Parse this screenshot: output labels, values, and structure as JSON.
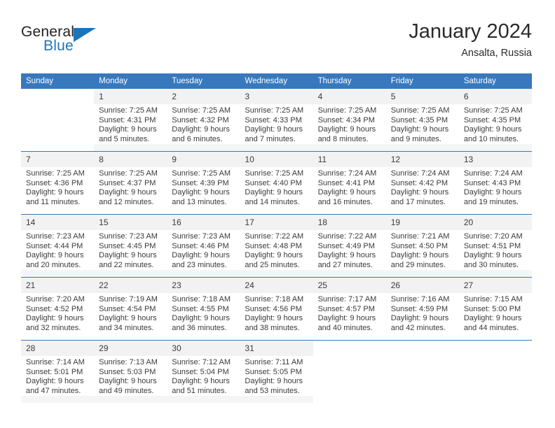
{
  "brand": {
    "name_part1": "General",
    "name_part2": "Blue",
    "logo_icon": "triangle-logo-icon",
    "accent_color": "#1b75bb"
  },
  "header": {
    "month_title": "January 2024",
    "location": "Ansalta, Russia"
  },
  "calendar": {
    "header_background": "#3878bd",
    "weekday_headers": [
      "Sunday",
      "Monday",
      "Tuesday",
      "Wednesday",
      "Thursday",
      "Friday",
      "Saturday"
    ],
    "weeks": [
      [
        {
          "day": "",
          "sunrise": "",
          "sunset": "",
          "daylight_line1": "",
          "daylight_line2": ""
        },
        {
          "day": "1",
          "sunrise": "Sunrise: 7:25 AM",
          "sunset": "Sunset: 4:31 PM",
          "daylight_line1": "Daylight: 9 hours",
          "daylight_line2": "and 5 minutes."
        },
        {
          "day": "2",
          "sunrise": "Sunrise: 7:25 AM",
          "sunset": "Sunset: 4:32 PM",
          "daylight_line1": "Daylight: 9 hours",
          "daylight_line2": "and 6 minutes."
        },
        {
          "day": "3",
          "sunrise": "Sunrise: 7:25 AM",
          "sunset": "Sunset: 4:33 PM",
          "daylight_line1": "Daylight: 9 hours",
          "daylight_line2": "and 7 minutes."
        },
        {
          "day": "4",
          "sunrise": "Sunrise: 7:25 AM",
          "sunset": "Sunset: 4:34 PM",
          "daylight_line1": "Daylight: 9 hours",
          "daylight_line2": "and 8 minutes."
        },
        {
          "day": "5",
          "sunrise": "Sunrise: 7:25 AM",
          "sunset": "Sunset: 4:35 PM",
          "daylight_line1": "Daylight: 9 hours",
          "daylight_line2": "and 9 minutes."
        },
        {
          "day": "6",
          "sunrise": "Sunrise: 7:25 AM",
          "sunset": "Sunset: 4:35 PM",
          "daylight_line1": "Daylight: 9 hours",
          "daylight_line2": "and 10 minutes."
        }
      ],
      [
        {
          "day": "7",
          "sunrise": "Sunrise: 7:25 AM",
          "sunset": "Sunset: 4:36 PM",
          "daylight_line1": "Daylight: 9 hours",
          "daylight_line2": "and 11 minutes."
        },
        {
          "day": "8",
          "sunrise": "Sunrise: 7:25 AM",
          "sunset": "Sunset: 4:37 PM",
          "daylight_line1": "Daylight: 9 hours",
          "daylight_line2": "and 12 minutes."
        },
        {
          "day": "9",
          "sunrise": "Sunrise: 7:25 AM",
          "sunset": "Sunset: 4:39 PM",
          "daylight_line1": "Daylight: 9 hours",
          "daylight_line2": "and 13 minutes."
        },
        {
          "day": "10",
          "sunrise": "Sunrise: 7:25 AM",
          "sunset": "Sunset: 4:40 PM",
          "daylight_line1": "Daylight: 9 hours",
          "daylight_line2": "and 14 minutes."
        },
        {
          "day": "11",
          "sunrise": "Sunrise: 7:24 AM",
          "sunset": "Sunset: 4:41 PM",
          "daylight_line1": "Daylight: 9 hours",
          "daylight_line2": "and 16 minutes."
        },
        {
          "day": "12",
          "sunrise": "Sunrise: 7:24 AM",
          "sunset": "Sunset: 4:42 PM",
          "daylight_line1": "Daylight: 9 hours",
          "daylight_line2": "and 17 minutes."
        },
        {
          "day": "13",
          "sunrise": "Sunrise: 7:24 AM",
          "sunset": "Sunset: 4:43 PM",
          "daylight_line1": "Daylight: 9 hours",
          "daylight_line2": "and 19 minutes."
        }
      ],
      [
        {
          "day": "14",
          "sunrise": "Sunrise: 7:23 AM",
          "sunset": "Sunset: 4:44 PM",
          "daylight_line1": "Daylight: 9 hours",
          "daylight_line2": "and 20 minutes."
        },
        {
          "day": "15",
          "sunrise": "Sunrise: 7:23 AM",
          "sunset": "Sunset: 4:45 PM",
          "daylight_line1": "Daylight: 9 hours",
          "daylight_line2": "and 22 minutes."
        },
        {
          "day": "16",
          "sunrise": "Sunrise: 7:23 AM",
          "sunset": "Sunset: 4:46 PM",
          "daylight_line1": "Daylight: 9 hours",
          "daylight_line2": "and 23 minutes."
        },
        {
          "day": "17",
          "sunrise": "Sunrise: 7:22 AM",
          "sunset": "Sunset: 4:48 PM",
          "daylight_line1": "Daylight: 9 hours",
          "daylight_line2": "and 25 minutes."
        },
        {
          "day": "18",
          "sunrise": "Sunrise: 7:22 AM",
          "sunset": "Sunset: 4:49 PM",
          "daylight_line1": "Daylight: 9 hours",
          "daylight_line2": "and 27 minutes."
        },
        {
          "day": "19",
          "sunrise": "Sunrise: 7:21 AM",
          "sunset": "Sunset: 4:50 PM",
          "daylight_line1": "Daylight: 9 hours",
          "daylight_line2": "and 29 minutes."
        },
        {
          "day": "20",
          "sunrise": "Sunrise: 7:20 AM",
          "sunset": "Sunset: 4:51 PM",
          "daylight_line1": "Daylight: 9 hours",
          "daylight_line2": "and 30 minutes."
        }
      ],
      [
        {
          "day": "21",
          "sunrise": "Sunrise: 7:20 AM",
          "sunset": "Sunset: 4:52 PM",
          "daylight_line1": "Daylight: 9 hours",
          "daylight_line2": "and 32 minutes."
        },
        {
          "day": "22",
          "sunrise": "Sunrise: 7:19 AM",
          "sunset": "Sunset: 4:54 PM",
          "daylight_line1": "Daylight: 9 hours",
          "daylight_line2": "and 34 minutes."
        },
        {
          "day": "23",
          "sunrise": "Sunrise: 7:18 AM",
          "sunset": "Sunset: 4:55 PM",
          "daylight_line1": "Daylight: 9 hours",
          "daylight_line2": "and 36 minutes."
        },
        {
          "day": "24",
          "sunrise": "Sunrise: 7:18 AM",
          "sunset": "Sunset: 4:56 PM",
          "daylight_line1": "Daylight: 9 hours",
          "daylight_line2": "and 38 minutes."
        },
        {
          "day": "25",
          "sunrise": "Sunrise: 7:17 AM",
          "sunset": "Sunset: 4:57 PM",
          "daylight_line1": "Daylight: 9 hours",
          "daylight_line2": "and 40 minutes."
        },
        {
          "day": "26",
          "sunrise": "Sunrise: 7:16 AM",
          "sunset": "Sunset: 4:59 PM",
          "daylight_line1": "Daylight: 9 hours",
          "daylight_line2": "and 42 minutes."
        },
        {
          "day": "27",
          "sunrise": "Sunrise: 7:15 AM",
          "sunset": "Sunset: 5:00 PM",
          "daylight_line1": "Daylight: 9 hours",
          "daylight_line2": "and 44 minutes."
        }
      ],
      [
        {
          "day": "28",
          "sunrise": "Sunrise: 7:14 AM",
          "sunset": "Sunset: 5:01 PM",
          "daylight_line1": "Daylight: 9 hours",
          "daylight_line2": "and 47 minutes."
        },
        {
          "day": "29",
          "sunrise": "Sunrise: 7:13 AM",
          "sunset": "Sunset: 5:03 PM",
          "daylight_line1": "Daylight: 9 hours",
          "daylight_line2": "and 49 minutes."
        },
        {
          "day": "30",
          "sunrise": "Sunrise: 7:12 AM",
          "sunset": "Sunset: 5:04 PM",
          "daylight_line1": "Daylight: 9 hours",
          "daylight_line2": "and 51 minutes."
        },
        {
          "day": "31",
          "sunrise": "Sunrise: 7:11 AM",
          "sunset": "Sunset: 5:05 PM",
          "daylight_line1": "Daylight: 9 hours",
          "daylight_line2": "and 53 minutes."
        },
        {
          "day": "",
          "sunrise": "",
          "sunset": "",
          "daylight_line1": "",
          "daylight_line2": ""
        },
        {
          "day": "",
          "sunrise": "",
          "sunset": "",
          "daylight_line1": "",
          "daylight_line2": ""
        },
        {
          "day": "",
          "sunrise": "",
          "sunset": "",
          "daylight_line1": "",
          "daylight_line2": ""
        }
      ]
    ]
  }
}
